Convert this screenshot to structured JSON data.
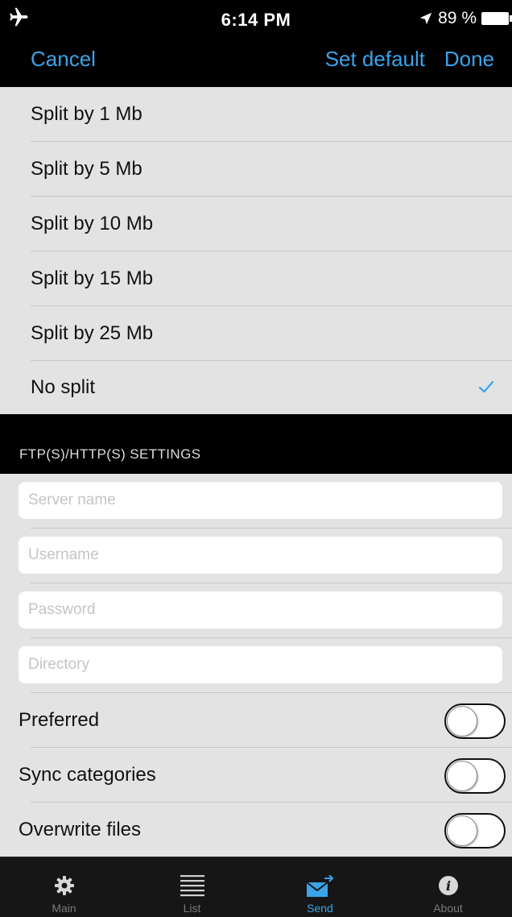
{
  "status_bar": {
    "time": "6:14 PM",
    "battery": "89 %"
  },
  "nav": {
    "cancel": "Cancel",
    "set_default": "Set default",
    "done": "Done"
  },
  "split_options": [
    {
      "label": "Split by 1 Mb",
      "selected": false
    },
    {
      "label": "Split by 5 Mb",
      "selected": false
    },
    {
      "label": "Split by 10 Mb",
      "selected": false
    },
    {
      "label": "Split by 15 Mb",
      "selected": false
    },
    {
      "label": "Split by 25 Mb",
      "selected": false
    },
    {
      "label": "No split",
      "selected": true
    }
  ],
  "section": {
    "title": "FTP(S)/HTTP(S) SETTINGS"
  },
  "fields": {
    "server": {
      "value": "",
      "placeholder": "Server name"
    },
    "username": {
      "value": "",
      "placeholder": "Username"
    },
    "password": {
      "value": "",
      "placeholder": "Password"
    },
    "directory": {
      "value": "",
      "placeholder": "Directory"
    }
  },
  "toggles": [
    {
      "label": "Preferred",
      "on": false
    },
    {
      "label": "Sync categories",
      "on": false
    },
    {
      "label": "Overwrite files",
      "on": false
    }
  ],
  "tabs": [
    {
      "label": "Main",
      "icon": "gear-icon",
      "active": false
    },
    {
      "label": "List",
      "icon": "list-icon",
      "active": false
    },
    {
      "label": "Send",
      "icon": "mail-send-icon",
      "active": true
    },
    {
      "label": "About",
      "icon": "info-icon",
      "active": false
    }
  ],
  "colors": {
    "accent": "#3aa3ea",
    "list_background": "#e3e3e3",
    "bar_background": "#000000"
  }
}
